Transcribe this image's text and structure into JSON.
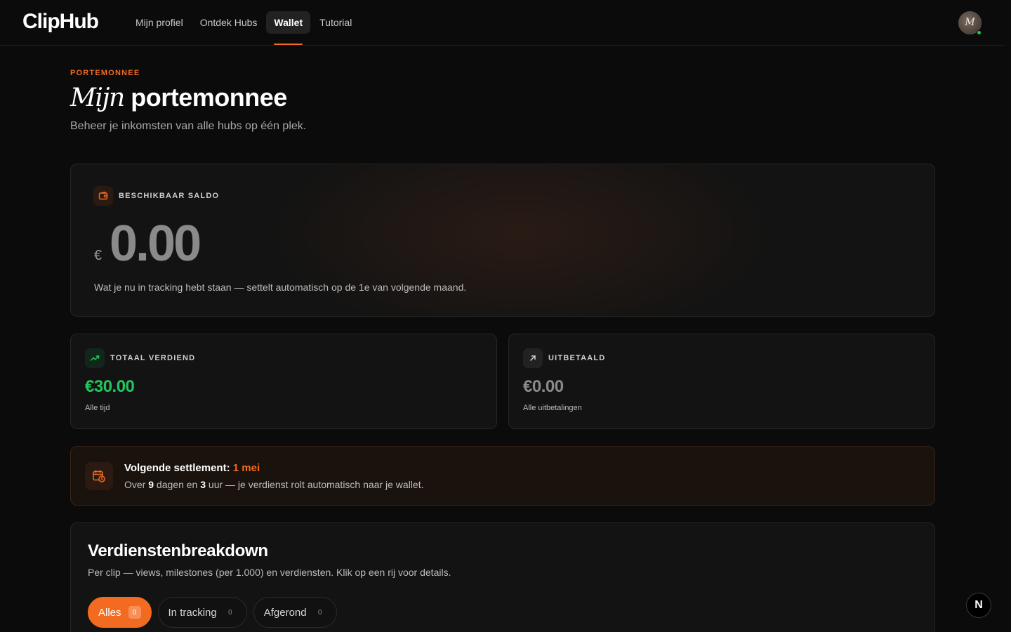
{
  "app": {
    "logo": "ClipHub"
  },
  "nav": {
    "items": [
      {
        "label": "Mijn profiel",
        "active": false
      },
      {
        "label": "Ontdek Hubs",
        "active": false
      },
      {
        "label": "Wallet",
        "active": true
      },
      {
        "label": "Tutorial",
        "active": false
      }
    ]
  },
  "user": {
    "avatar_initials": "M",
    "status": "online"
  },
  "header": {
    "eyebrow": "PORTEMONNEE",
    "title_italic": "Mijn",
    "title_rest": "portemonnee",
    "subtitle": "Beheer je inkomsten van alle hubs op één plek."
  },
  "balance": {
    "label": "BESCHIKBAAR SALDO",
    "currency": "€",
    "amount": "0.00",
    "note": "Wat je nu in tracking hebt staan — settelt automatisch op de 1e van volgende maand."
  },
  "stats": {
    "earned": {
      "label": "TOTAAL VERDIEND",
      "value": "€30.00",
      "sub": "Alle tijd",
      "color": "#22c55e"
    },
    "paid": {
      "label": "UITBETAALD",
      "value": "€0.00",
      "sub": "Alle uitbetalingen",
      "color": "#8a8a8a"
    }
  },
  "settlement": {
    "title_prefix": "Volgende settlement:",
    "date": "1 mei",
    "sub_over": "Over",
    "days": "9",
    "sub_days": "dagen en",
    "hours": "3",
    "sub_rest": "uur — je verdienst rolt automatisch naar je wallet."
  },
  "breakdown": {
    "title": "Verdienstenbreakdown",
    "subtitle": "Per clip — views, milestones (per 1.000) en verdiensten. Klik op een rij voor details.",
    "filters": [
      {
        "label": "Alles",
        "count": "0",
        "active": true
      },
      {
        "label": "In tracking",
        "count": "0",
        "active": false
      },
      {
        "label": "Afgerond",
        "count": "0",
        "active": false
      }
    ]
  },
  "dev_badge": {
    "label": "N"
  },
  "colors": {
    "accent": "#f26b21",
    "positive": "#22c55e",
    "background": "#0b0b0b"
  }
}
